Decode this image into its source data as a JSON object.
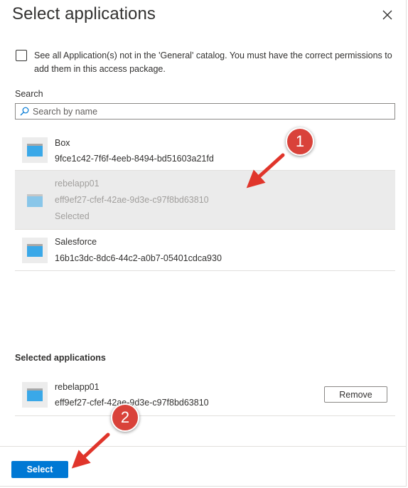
{
  "dialog": {
    "title": "Select applications",
    "close_icon": "close-icon"
  },
  "catalog_option": {
    "checked": false,
    "label": "See all Application(s) not in the 'General' catalog. You must have the correct permissions to add them in this access package."
  },
  "search": {
    "label": "Search",
    "placeholder": "Search by name",
    "value": "",
    "icon": "search-icon"
  },
  "applications": [
    {
      "name": "Box",
      "id": "9fce1c42-7f6f-4eeb-8494-bd51603a21fd",
      "status": "",
      "selected": false,
      "icon": "app-window-icon"
    },
    {
      "name": "rebelapp01",
      "id": "eff9ef27-cfef-42ae-9d3e-c97f8bd63810",
      "status": "Selected",
      "selected": true,
      "icon": "app-window-icon"
    },
    {
      "name": "Salesforce",
      "id": "16b1c3dc-8dc6-44c2-a0b7-05401cdca930",
      "status": "",
      "selected": false,
      "icon": "app-window-icon"
    }
  ],
  "selected_section": {
    "heading": "Selected applications",
    "items": [
      {
        "name": "rebelapp01",
        "id": "eff9ef27-cfef-42ae-9d3e-c97f8bd63810",
        "remove_label": "Remove",
        "icon": "app-window-icon"
      }
    ]
  },
  "footer": {
    "select_label": "Select"
  },
  "callouts": [
    {
      "number": "1"
    },
    {
      "number": "2"
    }
  ],
  "colors": {
    "primary": "#0078d4",
    "callout": "#d9423a",
    "selected_row": "#ebebeb"
  }
}
